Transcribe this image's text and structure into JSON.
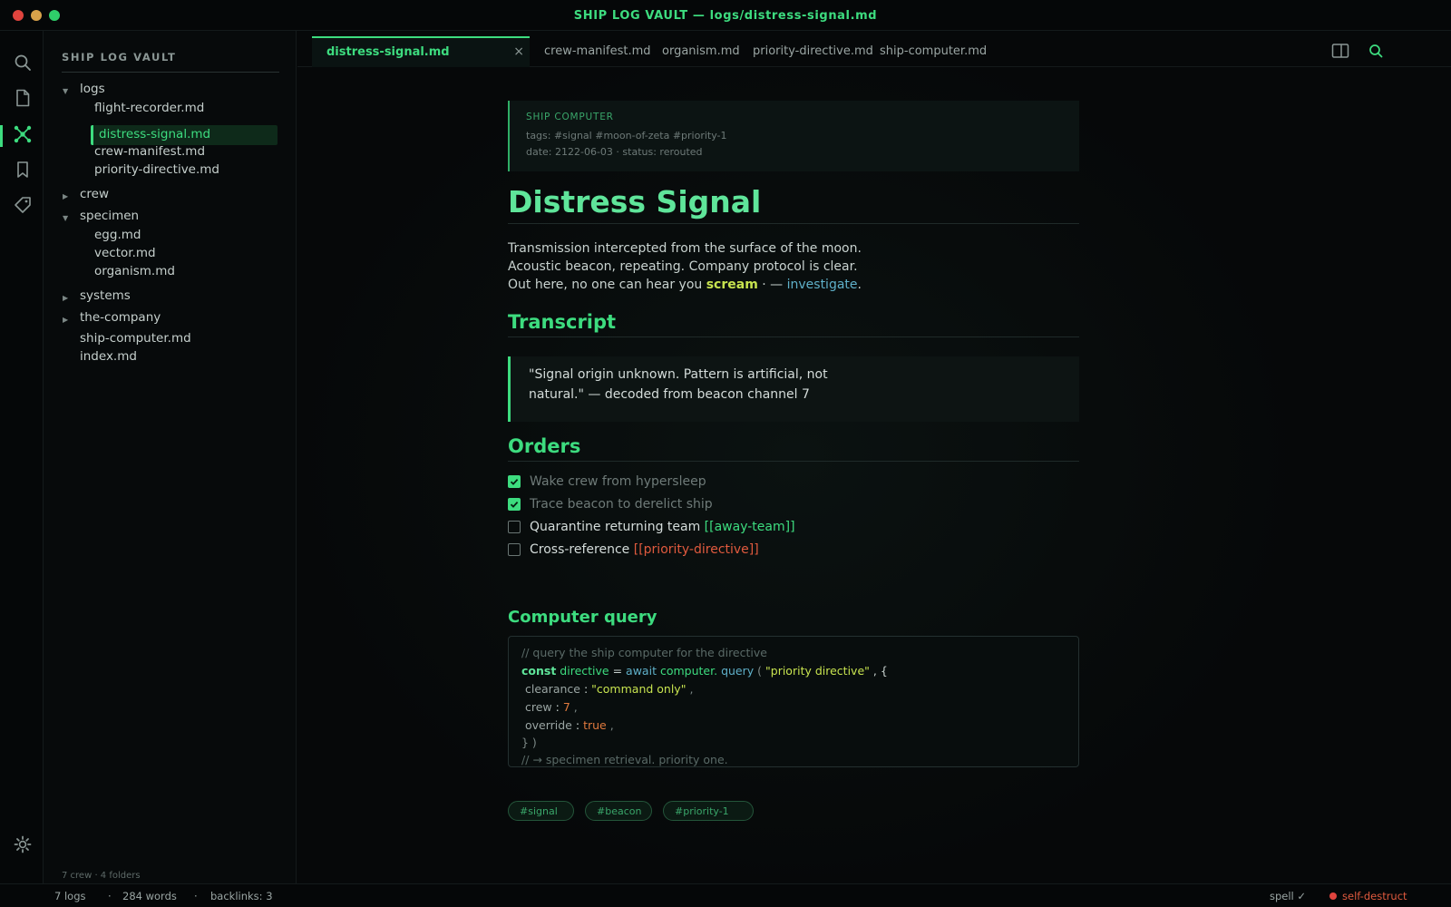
{
  "window": {
    "title": "SHIP LOG VAULT — logs/distress-signal.md"
  },
  "activity_bar": {
    "items": [
      {
        "icon": "search-icon"
      },
      {
        "icon": "file-icon"
      },
      {
        "icon": "graph-icon"
      },
      {
        "icon": "bookmark-icon"
      },
      {
        "icon": "tag-icon"
      }
    ],
    "settings_icon": "gear-icon"
  },
  "sidebar": {
    "title": "SHIP LOG VAULT",
    "tree": {
      "logs": {
        "label": "logs",
        "files": [
          "flight-recorder.md",
          "distress-signal.md",
          "crew-manifest.md",
          "priority-directive.md"
        ]
      },
      "crew": {
        "label": "crew"
      },
      "specimen": {
        "label": "specimen",
        "files": [
          "egg.md",
          "vector.md",
          "organism.md"
        ]
      },
      "systems": {
        "label": "systems"
      },
      "the_company": {
        "label": "the-company"
      },
      "root_files": [
        "ship-computer.md",
        "index.md"
      ]
    },
    "footer": "7 crew · 4 folders"
  },
  "tabs": {
    "active": "distress-signal.md",
    "close": "×",
    "others": [
      "crew-manifest.md",
      "organism.md",
      "priority-directive.md",
      "ship-computer.md"
    ]
  },
  "document": {
    "frontmatter": {
      "header": "SHIP COMPUTER",
      "tags_line": "tags: #signal #moon-of-zeta #priority-1",
      "meta_line": "date: 2122-06-03 · status: rerouted"
    },
    "title": "Distress Signal",
    "intro": {
      "line1": "Transmission intercepted from the surface of the moon.",
      "line2": "Acoustic beacon, repeating. Company protocol is clear.",
      "line3_prefix": "Out here, no one can hear you ",
      "line3_strong": "scream",
      "line3_mid": " · — ",
      "line3_link": "investigate",
      "line3_end": "."
    },
    "transcript": {
      "heading": "Transcript",
      "quote_line1": "\"Signal origin unknown. Pattern is artificial, not",
      "quote_line2": "natural.\" — decoded from beacon channel 7"
    },
    "orders": {
      "heading": "Orders",
      "items": [
        {
          "text": "Wake crew from hypersleep",
          "checked": true
        },
        {
          "text": "Trace beacon to derelict ship",
          "checked": true
        },
        {
          "text": "Quarantine returning team ",
          "link": "[[away-team]]",
          "checked": false
        },
        {
          "text": "Cross-reference ",
          "link": "[[priority-directive]]",
          "checked": false
        }
      ]
    },
    "query": {
      "heading": "Computer query",
      "comment1": "// query the ship computer for the directive",
      "kw_const": "const",
      "var_name": "directive",
      "eq": "=",
      "kw_await": "await",
      "obj": "computer.",
      "method": "query",
      "paren_open": "(",
      "arg_string": "\"priority directive\"",
      "comma_brace": ", {",
      "key_clearance": "clearance",
      "val_clearance": "\"command only\"",
      "key_crew": "crew",
      "val_crew": "7",
      "key_override": "override",
      "val_override": "true",
      "colon": ":",
      "comma": ",",
      "close": "} )",
      "comment2": "// → specimen retrieval. priority one."
    },
    "tags": [
      "#signal",
      "#beacon",
      "#priority-1"
    ]
  },
  "status_bar": {
    "logs": "7 logs",
    "sep": "·",
    "words": "284 words",
    "backlinks": "backlinks: 3",
    "spell": "spell ✓",
    "self_destruct": "self-destruct"
  },
  "colors": {
    "accent": "#3ddc7f",
    "accent_light": "#5fe59a",
    "link_blue": "#5fb0c9",
    "highlight_yellow": "#c7e34f",
    "danger": "#e05a3e",
    "background": "#060809"
  }
}
